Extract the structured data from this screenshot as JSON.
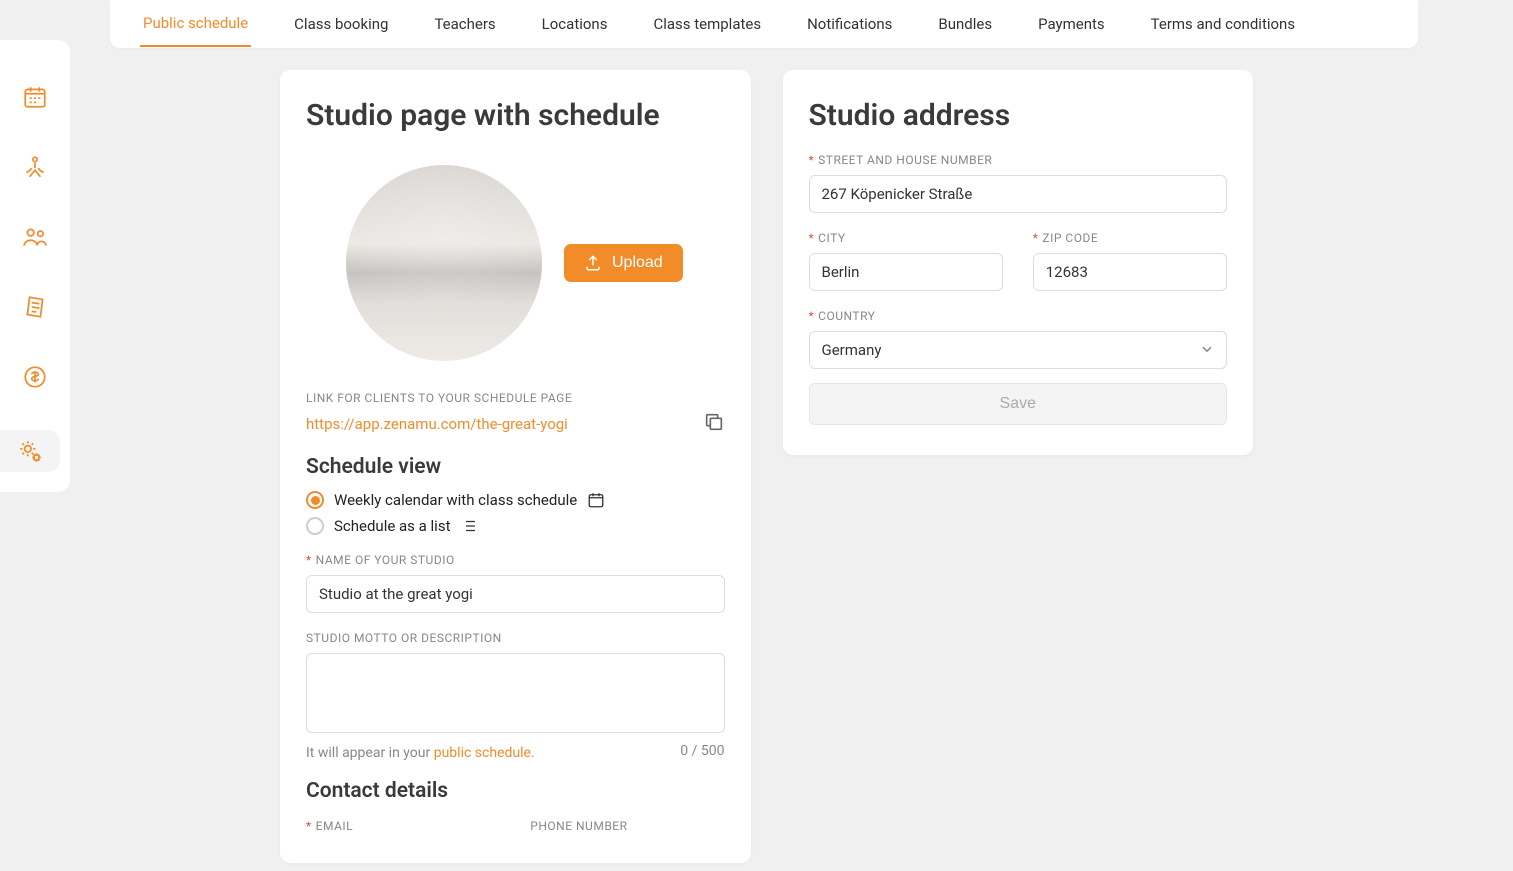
{
  "tabs": [
    "Public schedule",
    "Class booking",
    "Teachers",
    "Locations",
    "Class templates",
    "Notifications",
    "Bundles",
    "Payments",
    "Terms and conditions"
  ],
  "leftCard": {
    "title": "Studio page with schedule",
    "uploadLabel": "Upload",
    "linkLabel": "LINK FOR CLIENTS TO YOUR SCHEDULE PAGE",
    "link": "https://app.zenamu.com/the-great-yogi",
    "scheduleViewTitle": "Schedule view",
    "radio1": "Weekly calendar with class schedule",
    "radio2": "Schedule as a list",
    "studioNameLabel": "NAME OF YOUR STUDIO",
    "studioName": "Studio at the great yogi",
    "mottoLabel": "STUDIO MOTTO OR DESCRIPTION",
    "motto": "",
    "counter": "0 / 500",
    "helperPrefix": "It will appear in your ",
    "helperLink": "public schedule.",
    "contactTitle": "Contact details",
    "emailLabel": "EMAIL",
    "phoneLabel": "PHONE NUMBER"
  },
  "rightCard": {
    "title": "Studio address",
    "streetLabel": "STREET AND HOUSE NUMBER",
    "street": "267 Köpenicker Straße",
    "cityLabel": "CITY",
    "city": "Berlin",
    "zipLabel": "ZIP CODE",
    "zip": "12683",
    "countryLabel": "COUNTRY",
    "country": "Germany",
    "saveLabel": "Save"
  }
}
